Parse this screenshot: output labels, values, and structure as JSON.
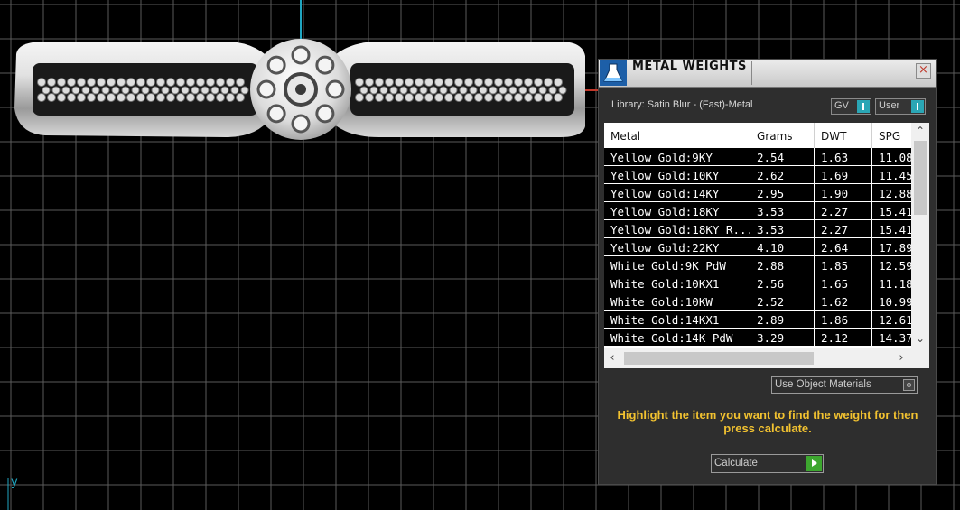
{
  "viewport": {
    "axis_label": "y",
    "colors": {
      "background": "#000000",
      "grid": "#5a5a5a",
      "axis": "#1fa5c0"
    }
  },
  "panel": {
    "title": "METAL WEIGHTS",
    "close_label": "×",
    "library_label": "Library: Satin Blur - (Fast)-Metal",
    "toggle_gv": "GV",
    "toggle_user": "User",
    "table": {
      "columns": [
        "Metal",
        "Grams",
        "DWT",
        "SPG"
      ],
      "rows": [
        [
          "Yellow Gold:9KY",
          "2.54",
          "1.63",
          "11.08"
        ],
        [
          "Yellow Gold:10KY",
          "2.62",
          "1.69",
          "11.45"
        ],
        [
          "Yellow Gold:14KY",
          "2.95",
          "1.90",
          "12.88"
        ],
        [
          "Yellow Gold:18KY",
          "3.53",
          "2.27",
          "15.41"
        ],
        [
          "Yellow Gold:18KY R...",
          "3.53",
          "2.27",
          "15.41"
        ],
        [
          "Yellow Gold:22KY",
          "4.10",
          "2.64",
          "17.89"
        ],
        [
          "White Gold:9K PdW",
          "2.88",
          "1.85",
          "12.59"
        ],
        [
          "White Gold:10KX1",
          "2.56",
          "1.65",
          "11.18"
        ],
        [
          "White Gold:10KW",
          "2.52",
          "1.62",
          "10.99"
        ],
        [
          "White Gold:14KX1",
          "2.89",
          "1.86",
          "12.61"
        ],
        [
          "White Gold:14K PdW",
          "3.29",
          "2.12",
          "14.37"
        ]
      ]
    },
    "use_object_materials": "Use Object Materials",
    "hint": "Highlight the item you want to find the weight for then press calculate.",
    "calculate_label": "Calculate",
    "colors": {
      "panel": "#2e2e2e",
      "hint": "#f2c230",
      "toggle": "#2aa6b5",
      "go": "#3da72f"
    }
  }
}
